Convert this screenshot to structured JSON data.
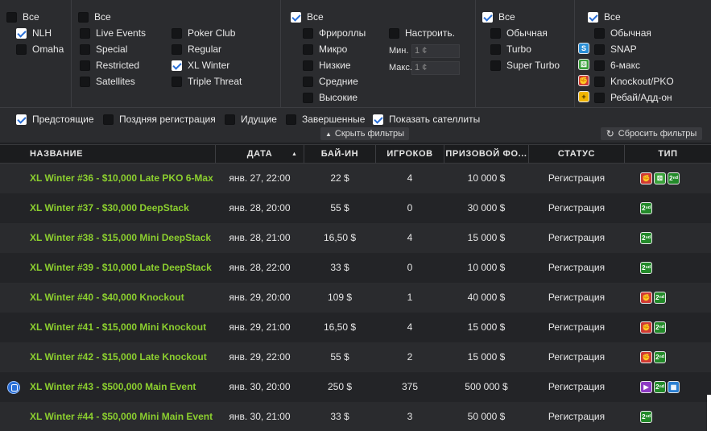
{
  "filters": {
    "col1": {
      "all": "Все",
      "nlh": "NLH",
      "omaha": "Omaha"
    },
    "col2": {
      "all": "Все",
      "items_left": [
        "Live Events",
        "Special",
        "Restricted",
        "Satellites"
      ],
      "items_right": [
        "Poker Club",
        "Regular",
        "XL Winter",
        "Triple Threat"
      ]
    },
    "col3": {
      "all": "Все",
      "items": [
        "Фрироллы",
        "Микро",
        "Низкие",
        "Средние",
        "Высокие"
      ],
      "custom": "Настроить.",
      "min_label": "Мин.",
      "min_placeholder": "1 ¢",
      "max_label": "Макс.",
      "max_placeholder": "1 ¢"
    },
    "col4": {
      "all": "Все",
      "items": [
        "Обычная",
        "Turbo",
        "Super Turbo"
      ]
    },
    "col5": {
      "all": "Все",
      "items": [
        "Обычная",
        "SNAP",
        "6-макс",
        "Knockout/PKO",
        "Ребай/Адд-он"
      ]
    },
    "status": [
      "Предстоящие",
      "Поздняя регистрация",
      "Идущие",
      "Завершенные",
      "Показать сателлиты"
    ],
    "hide_filters": "Скрыть фильтры",
    "reset_filters": "Сбросить фильтры"
  },
  "table": {
    "headers": [
      "НАЗВАНИЕ",
      "ДАТА",
      "БАЙ-ИН",
      "ИГРОКОВ",
      "ПРИЗОВОЙ ФО...",
      "СТАТУС",
      "ТИП"
    ],
    "rows": [
      {
        "name": "XL Winter #36 - $10,000 Late PKO 6-Max",
        "date": "янв. 27, 22:00",
        "buyin": "22 $",
        "players": "4",
        "prize": "10 000 $",
        "status": "Регистрация",
        "types": [
          "ko",
          "six",
          "late"
        ]
      },
      {
        "name": "XL Winter #37 - $30,000 DeepStack",
        "date": "янв. 28, 20:00",
        "buyin": "55 $",
        "players": "0",
        "prize": "30 000 $",
        "status": "Регистрация",
        "types": [
          "late"
        ]
      },
      {
        "name": "XL Winter #38 - $15,000 Mini DeepStack",
        "date": "янв. 28, 21:00",
        "buyin": "16,50 $",
        "players": "4",
        "prize": "15 000 $",
        "status": "Регистрация",
        "types": [
          "late"
        ]
      },
      {
        "name": "XL Winter #39 - $10,000 Late DeepStack",
        "date": "янв. 28, 22:00",
        "buyin": "33 $",
        "players": "0",
        "prize": "10 000 $",
        "status": "Регистрация",
        "types": [
          "late"
        ]
      },
      {
        "name": "XL Winter #40 - $40,000 Knockout",
        "date": "янв. 29, 20:00",
        "buyin": "109 $",
        "players": "1",
        "prize": "40 000 $",
        "status": "Регистрация",
        "types": [
          "ko",
          "late"
        ]
      },
      {
        "name": "XL Winter #41 - $15,000 Mini Knockout",
        "date": "янв. 29, 21:00",
        "buyin": "16,50 $",
        "players": "4",
        "prize": "15 000 $",
        "status": "Регистрация",
        "types": [
          "ko",
          "late"
        ]
      },
      {
        "name": "XL Winter #42 - $15,000 Late Knockout",
        "date": "янв. 29, 22:00",
        "buyin": "55 $",
        "players": "2",
        "prize": "15 000 $",
        "status": "Регистрация",
        "types": [
          "ko",
          "late"
        ]
      },
      {
        "name": "XL Winter #43 - $500,000 Main Event",
        "date": "янв. 30, 20:00",
        "buyin": "250 $",
        "players": "375",
        "prize": "500 000 $",
        "status": "Регистрация",
        "types": [
          "video",
          "late",
          "cal"
        ],
        "featured": true
      },
      {
        "name": "XL Winter #44 - $50,000 Mini Main Event",
        "date": "янв. 30, 21:00",
        "buyin": "33 $",
        "players": "3",
        "prize": "50 000 $",
        "status": "Регистрация",
        "types": [
          "late"
        ]
      }
    ]
  },
  "icons": {
    "late": "2ⁿᵈ",
    "six": "⚄",
    "ko": "✊",
    "video": "▶",
    "cal": "▦",
    "snap": "S",
    "rebuy": "+"
  },
  "colors": {
    "accent_green": "#8ccf2f",
    "check_blue": "#2a6fd6",
    "bg": "#1e1f22"
  }
}
